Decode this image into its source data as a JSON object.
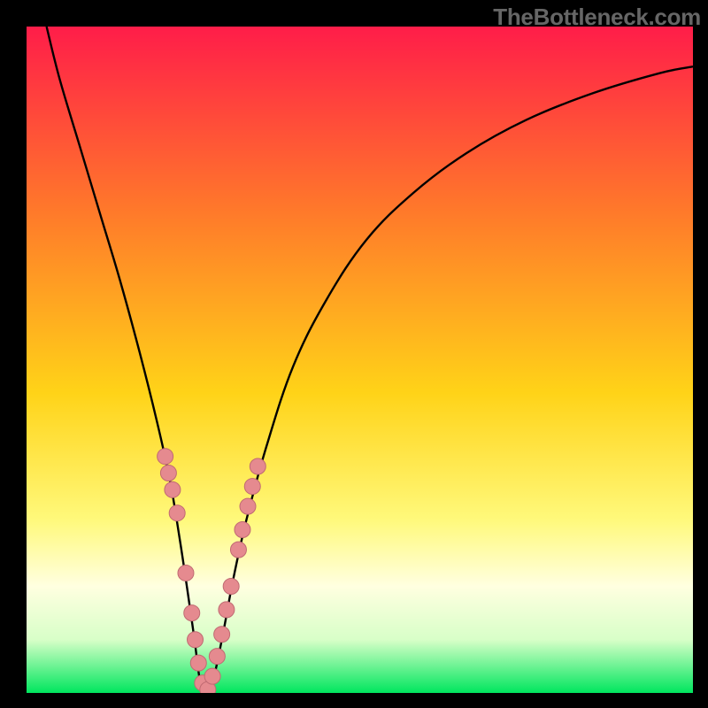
{
  "attribution": "TheBottleneck.com",
  "colors": {
    "frame": "#000000",
    "gradient_top": "#ff1d49",
    "gradient_mid_upper": "#ff7a2a",
    "gradient_mid": "#ffd318",
    "gradient_lower": "#fff97b",
    "gradient_pale": "#ffffe0",
    "gradient_bottom": "#00e65e",
    "curve": "#000000",
    "dot_fill": "#e58a8f",
    "dot_stroke": "#c06a72"
  },
  "chart_data": {
    "type": "line",
    "title": "",
    "xlabel": "",
    "ylabel": "",
    "xlim": [
      0,
      100
    ],
    "ylim": [
      0,
      100
    ],
    "series": [
      {
        "name": "bottleneck-curve",
        "x": [
          3,
          5,
          8,
          11,
          14,
          17,
          19.5,
          21.5,
          23,
          24.2,
          25.2,
          26,
          26.8,
          28,
          29.5,
          31,
          33,
          36,
          40,
          45,
          51,
          58,
          66,
          75,
          85,
          95,
          100
        ],
        "y": [
          100,
          92,
          82,
          72,
          62,
          51,
          41,
          32,
          23,
          15,
          8,
          2,
          0,
          2,
          9,
          17,
          26,
          37,
          49,
          59,
          68,
          75,
          81,
          86,
          90,
          93,
          94
        ]
      }
    ],
    "scatter": [
      {
        "name": "left-arm-dots",
        "points": [
          {
            "x": 20.8,
            "y": 35.5
          },
          {
            "x": 21.3,
            "y": 33.0
          },
          {
            "x": 21.9,
            "y": 30.5
          },
          {
            "x": 22.6,
            "y": 27.0
          },
          {
            "x": 23.9,
            "y": 18.0
          },
          {
            "x": 24.8,
            "y": 12.0
          },
          {
            "x": 25.3,
            "y": 8.0
          },
          {
            "x": 25.8,
            "y": 4.5
          },
          {
            "x": 26.4,
            "y": 1.5
          }
        ]
      },
      {
        "name": "right-arm-dots",
        "points": [
          {
            "x": 27.2,
            "y": 0.5
          },
          {
            "x": 27.9,
            "y": 2.5
          },
          {
            "x": 28.6,
            "y": 5.5
          },
          {
            "x": 29.3,
            "y": 8.8
          },
          {
            "x": 30.0,
            "y": 12.5
          },
          {
            "x": 30.7,
            "y": 16.0
          },
          {
            "x": 31.8,
            "y": 21.5
          },
          {
            "x": 32.4,
            "y": 24.5
          },
          {
            "x": 33.2,
            "y": 28.0
          },
          {
            "x": 33.9,
            "y": 31.0
          },
          {
            "x": 34.7,
            "y": 34.0
          }
        ]
      }
    ]
  }
}
